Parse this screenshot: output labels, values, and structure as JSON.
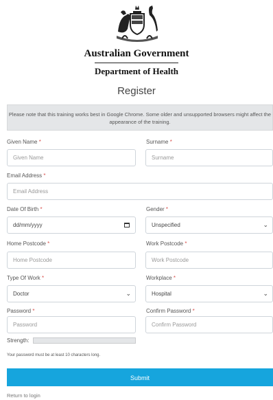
{
  "header": {
    "crest_icon": "australian-coat-of-arms",
    "government": "Australian Government",
    "department": "Department of Health"
  },
  "page_title": "Register",
  "notice": "Please note that this training works best in Google Chrome. Some older and unsupported browsers might affect the appearance of the training.",
  "form": {
    "required_marker": "*",
    "given_name": {
      "label": "Given Name",
      "placeholder": "Given Name"
    },
    "surname": {
      "label": "Surname",
      "placeholder": "Surname"
    },
    "email": {
      "label": "Email Address",
      "placeholder": "Email Address"
    },
    "dob": {
      "label": "Date Of Birth",
      "value": "dd/mm/yyyy"
    },
    "gender": {
      "label": "Gender",
      "value": "Unspecified"
    },
    "home_postcode": {
      "label": "Home Postcode",
      "placeholder": "Home Postcode"
    },
    "work_postcode": {
      "label": "Work Postcode",
      "placeholder": "Work Postcode"
    },
    "type_of_work": {
      "label": "Type Of Work",
      "value": "Doctor"
    },
    "workplace": {
      "label": "Workplace",
      "value": "Hospital"
    },
    "password": {
      "label": "Password",
      "placeholder": "Password"
    },
    "confirm_password": {
      "label": "Confirm Password",
      "placeholder": "Confirm Password"
    },
    "strength_label": "Strength:",
    "password_hint": "Your password must be at least 10 characters long.",
    "submit_label": "Submit",
    "return_link": "Return to login"
  },
  "colors": {
    "accent": "#16a5dd",
    "notice_bg": "#e4e6e8",
    "required": "#d9534f"
  }
}
